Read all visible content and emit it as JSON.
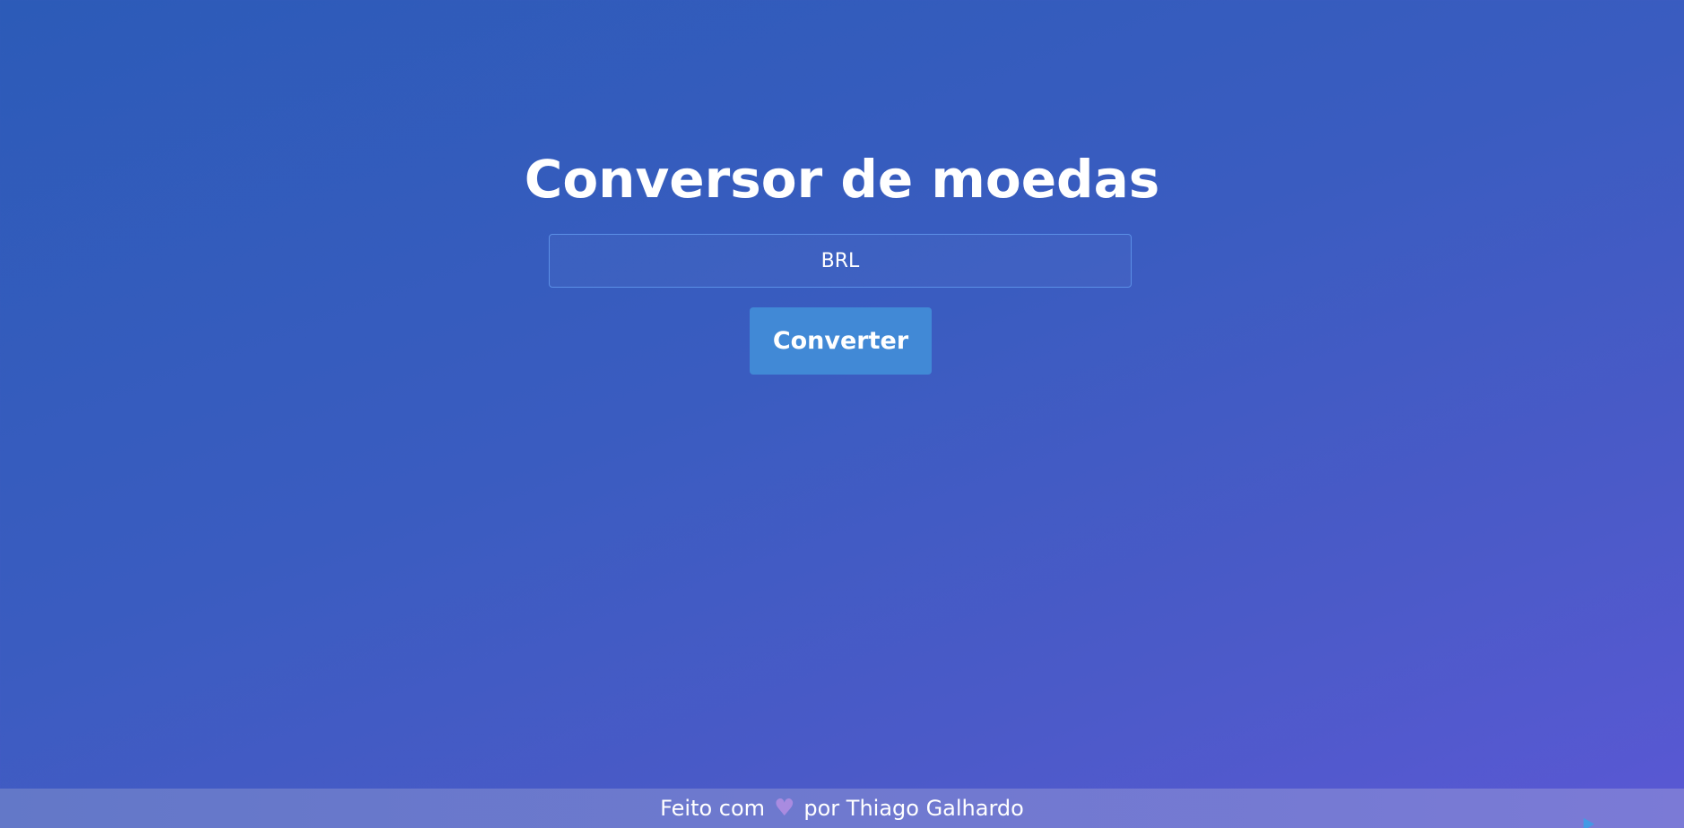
{
  "page": {
    "title": "Conversor de moedas"
  },
  "converter": {
    "input_value": "BRL",
    "button_label": "Converter"
  },
  "footer": {
    "prefix": "Feito com",
    "icon": "heart-icon",
    "suffix": "por Thiago Galhardo"
  },
  "colors": {
    "background_start": "#2c5bb8",
    "background_end": "#5a58d4",
    "button": "#4189d6",
    "input_border": "#5b8fe6",
    "heart": "#a98be0",
    "footer": "#6f79cf"
  }
}
